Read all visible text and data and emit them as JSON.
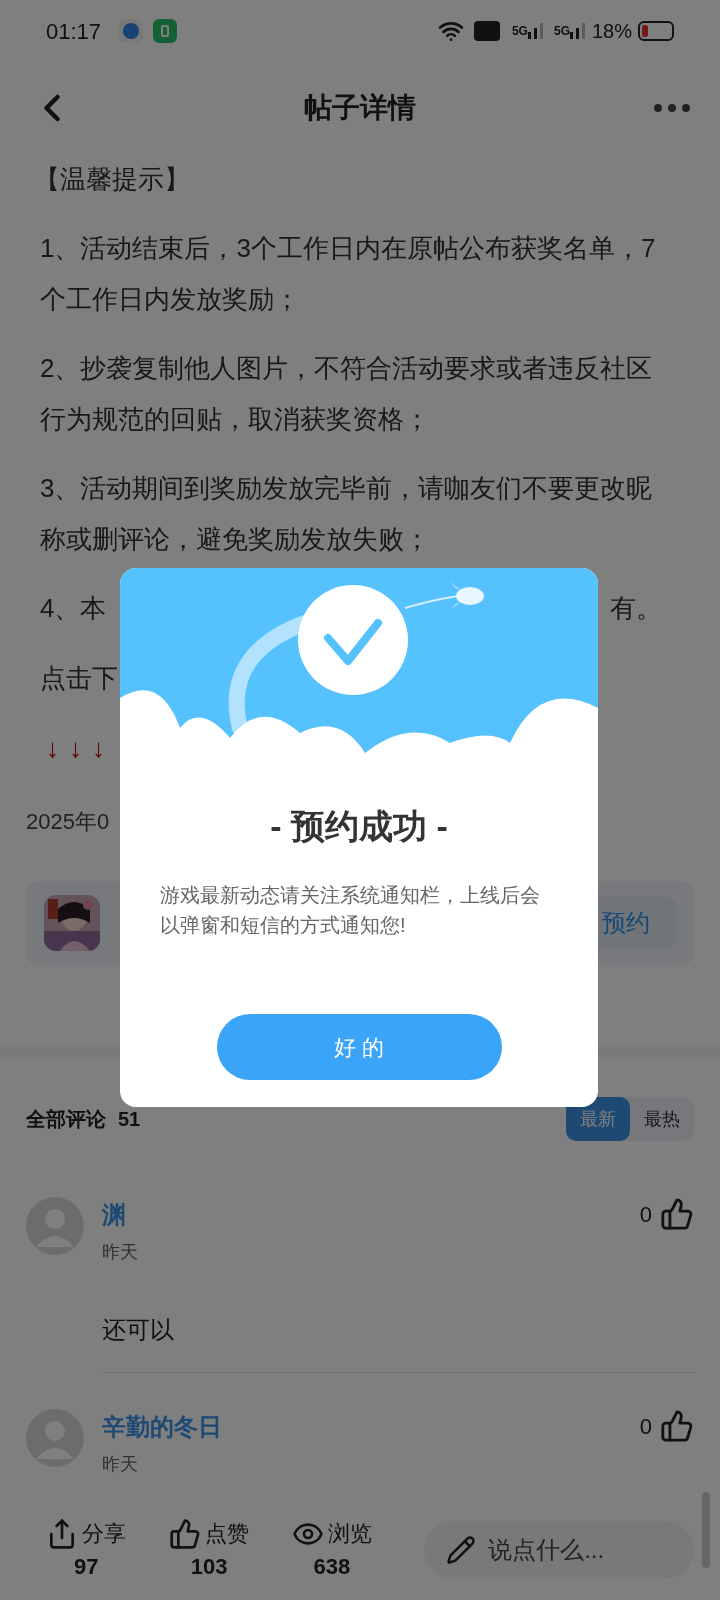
{
  "status_bar": {
    "time": "01:17",
    "sim_1": "5G",
    "sim_2": "5G",
    "battery": "18%"
  },
  "header": {
    "title": "帖子详情"
  },
  "post": {
    "paragraphs": [
      "【温馨提示】",
      "1、活动结束后，3个工作日内在原帖公布获奖名单，7个工作日内发放奖励；",
      "2、抄袭复制他人图片，不符合活动要求或者违反社区行为规范的回贴，取消获奖资格；",
      "3、活动期间到奖励发放完毕前，请咖友们不要更改昵称或删评论，避免奖励发放失败；"
    ],
    "covered_lines": [
      {
        "left": "4、本",
        "right": "有。"
      },
      {
        "left": "点击下"
      }
    ],
    "arrows": [
      "↓",
      "↓",
      "↓"
    ],
    "date": "2025年0",
    "game_card": {
      "button": "预约"
    }
  },
  "comments": {
    "title": "全部评论",
    "count": "51",
    "sort_tabs": [
      {
        "label": "最新",
        "selected": true
      },
      {
        "label": "最热",
        "selected": false
      }
    ],
    "items": [
      {
        "name": "渊",
        "time": "昨天",
        "likes": "0",
        "text": "还可以"
      },
      {
        "name": "辛勤的冬日",
        "time": "昨天",
        "likes": "0"
      }
    ]
  },
  "bottom_bar": {
    "actions": [
      {
        "kind": "share",
        "label": "分享",
        "count": "97"
      },
      {
        "kind": "like",
        "label": "点赞",
        "count": "103"
      },
      {
        "kind": "view",
        "label": "浏览",
        "count": "638"
      }
    ],
    "input_placeholder": "说点什么..."
  },
  "dialog": {
    "title": "- 预约成功 -",
    "message": "游戏最新动态请关注系统通知栏，上线后会以弹窗和短信的方式通知您!",
    "button": "好 的"
  }
}
